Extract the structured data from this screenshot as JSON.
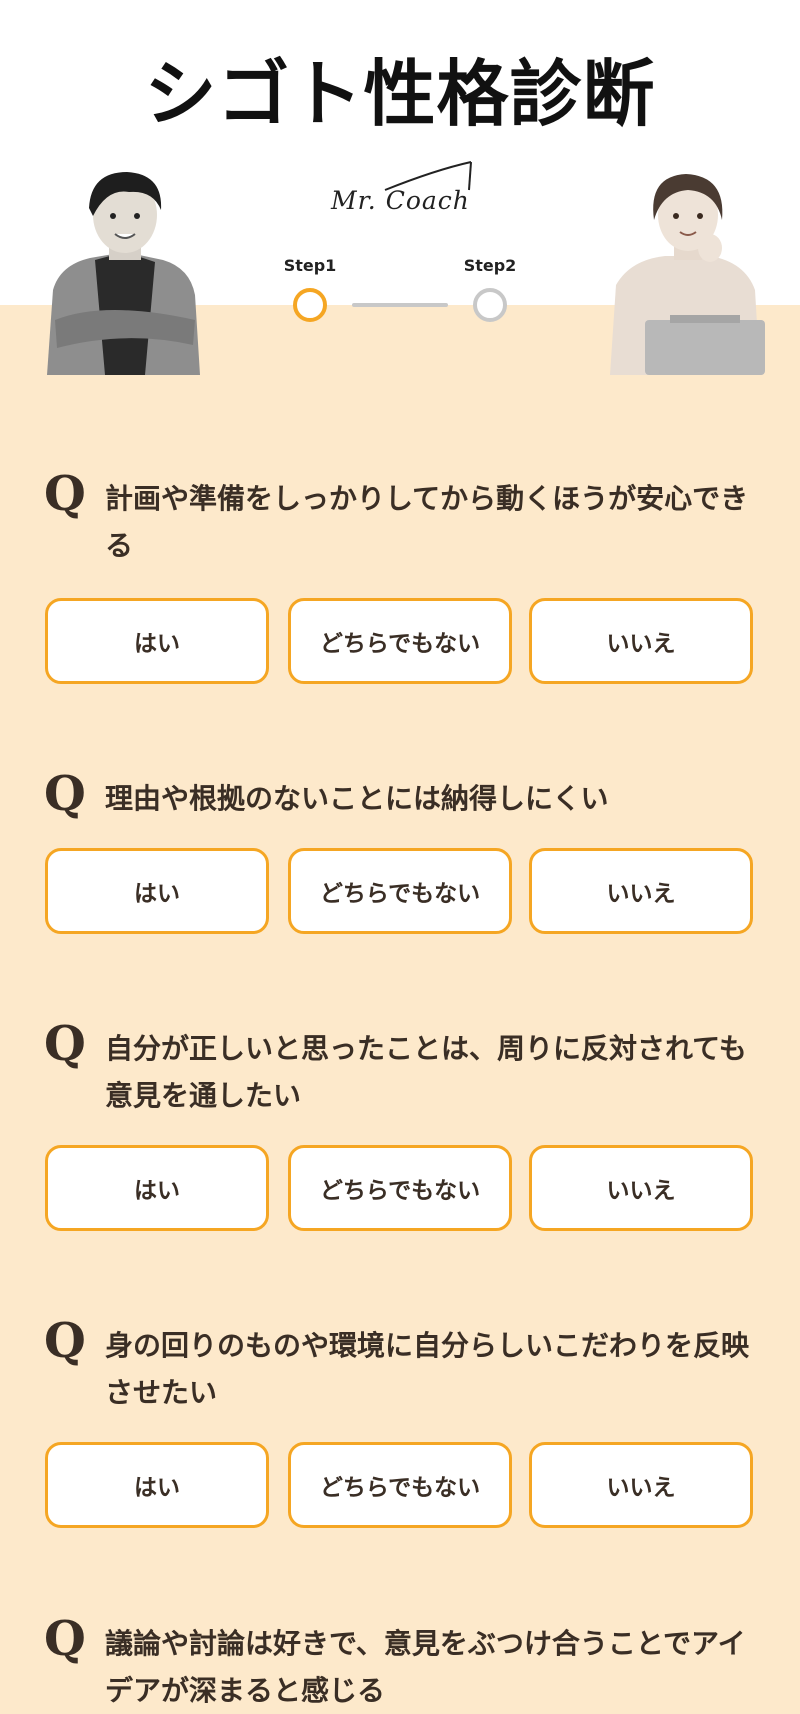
{
  "header": {
    "title": "シゴト性格診断",
    "brand": "Mr. Coach"
  },
  "steps": [
    {
      "label": "Step1",
      "state": "active"
    },
    {
      "label": "Step2",
      "state": "inactive"
    }
  ],
  "colors": {
    "accent": "#f5a623",
    "background": "#fde9cb",
    "text": "#3a2e25",
    "inactive": "#c8c8c8"
  },
  "question_mark": "Q",
  "questions": [
    {
      "text": "計画や準備をしっかりしてから動くほうが安心できる",
      "options": [
        "はい",
        "どちらでもない",
        "いいえ"
      ]
    },
    {
      "text": "理由や根拠のないことには納得しにくい",
      "options": [
        "はい",
        "どちらでもない",
        "いいえ"
      ]
    },
    {
      "text": "自分が正しいと思ったことは、周りに反対されても意見を通したい",
      "options": [
        "はい",
        "どちらでもない",
        "いいえ"
      ]
    },
    {
      "text": "身の回りのものや環境に自分らしいこだわりを反映させたい",
      "options": [
        "はい",
        "どちらでもない",
        "いいえ"
      ]
    },
    {
      "text": "議論や討論は好きで、意見をぶつけ合うことでアイデアが深まると感じる",
      "options": []
    }
  ]
}
